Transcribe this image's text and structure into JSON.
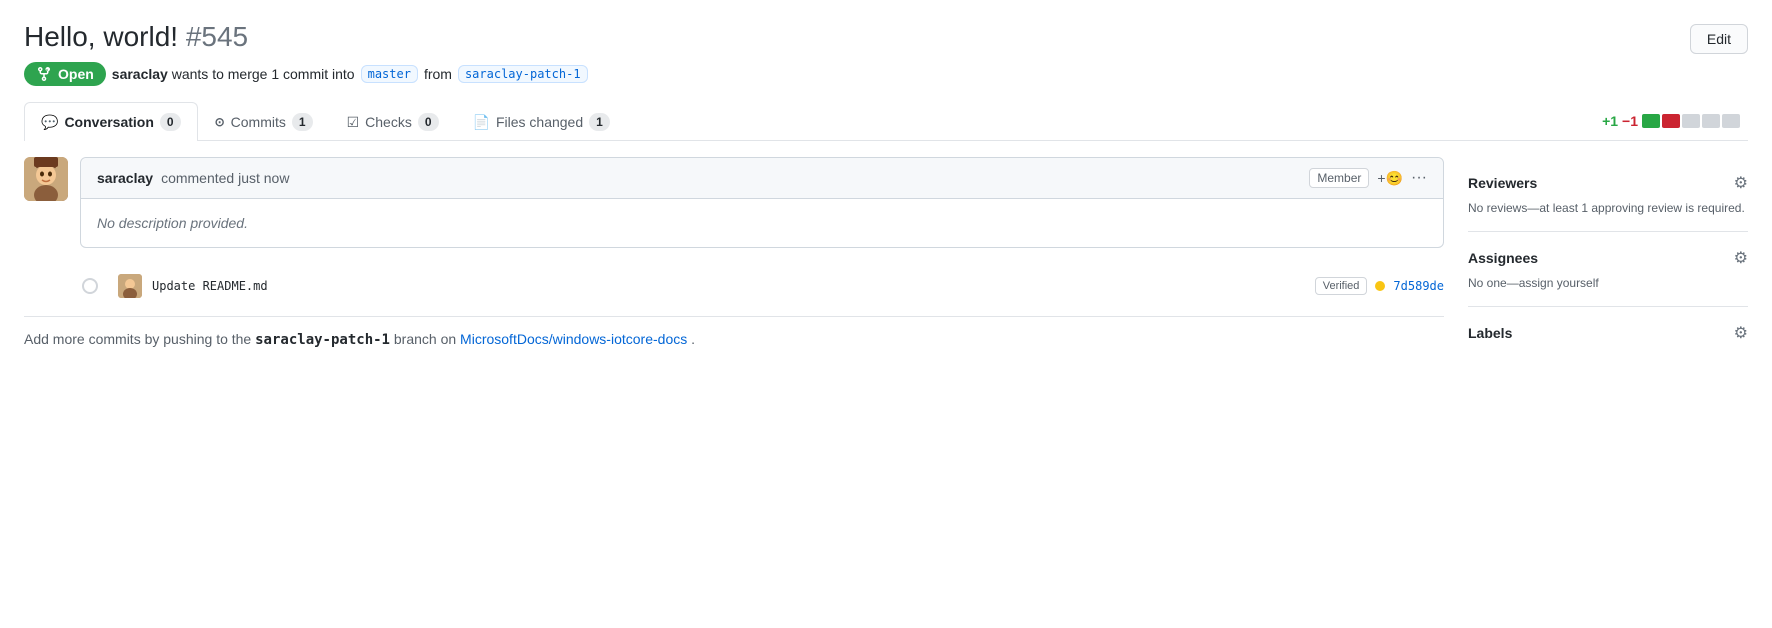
{
  "page": {
    "title": "Hello, world!",
    "pr_number": "#545",
    "edit_button": "Edit"
  },
  "pr_meta": {
    "status": "Open",
    "user": "saraclay",
    "description": "wants to merge 1 commit into",
    "target_branch": "master",
    "from_text": "from",
    "source_branch": "saraclay-patch-1"
  },
  "tabs": [
    {
      "id": "conversation",
      "icon": "💬",
      "label": "Conversation",
      "count": "0",
      "active": true
    },
    {
      "id": "commits",
      "icon": "⊙",
      "label": "Commits",
      "count": "1",
      "active": false
    },
    {
      "id": "checks",
      "icon": "☑",
      "label": "Checks",
      "count": "0",
      "active": false
    },
    {
      "id": "files-changed",
      "icon": "📄",
      "label": "Files changed",
      "count": "1",
      "active": false
    }
  ],
  "diff_stats": {
    "add": "+1",
    "del": "−1",
    "blocks": [
      "green",
      "red",
      "gray",
      "gray",
      "gray"
    ]
  },
  "comment": {
    "author": "saraclay",
    "action": "commented just now",
    "badge": "Member",
    "body": "No description provided."
  },
  "commit": {
    "message": "Update README.md",
    "verified": "Verified",
    "sha": "7d589de"
  },
  "footer": {
    "text_before": "Add more commits by pushing to the",
    "branch": "saraclay-patch-1",
    "text_middle": "branch on",
    "repo": "MicrosoftDocs/windows-iotcore-docs",
    "text_after": "."
  },
  "sidebar": {
    "reviewers": {
      "title": "Reviewers",
      "text": "No reviews—at least 1 approving review is required."
    },
    "assignees": {
      "title": "Assignees",
      "text": "No one—assign yourself"
    },
    "labels": {
      "title": "Labels"
    }
  },
  "icons": {
    "merge": "⑂",
    "gear": "⚙"
  }
}
